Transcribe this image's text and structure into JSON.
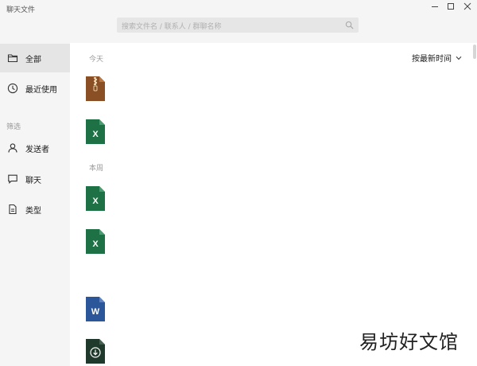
{
  "window": {
    "title": "聊天文件",
    "controls": {
      "minimize_icon": "minimize-icon",
      "maximize_icon": "maximize-icon",
      "close_icon": "close-icon"
    }
  },
  "search": {
    "placeholder": "搜索文件名 / 联系人 / 群聊名称",
    "icon": "search-icon"
  },
  "sidebar": {
    "items": [
      {
        "label": "全部",
        "icon": "folder-icon",
        "active": true
      },
      {
        "label": "最近使用",
        "icon": "clock-icon",
        "active": false
      }
    ],
    "filter_label": "筛选",
    "filters": [
      {
        "label": "发送者",
        "icon": "person-icon"
      },
      {
        "label": "聊天",
        "icon": "chat-bubble-icon"
      },
      {
        "label": "类型",
        "icon": "document-icon"
      }
    ]
  },
  "main": {
    "sort_label": "按最新时间",
    "sections": [
      {
        "label": "今天",
        "files": [
          {
            "type": "archive"
          },
          {
            "type": "excel",
            "glyph": "X"
          }
        ]
      },
      {
        "label": "本周",
        "files": [
          {
            "type": "excel",
            "glyph": "X"
          },
          {
            "type": "excel",
            "glyph": "X"
          },
          {
            "type": "word",
            "glyph": "W"
          },
          {
            "type": "download"
          }
        ]
      }
    ]
  },
  "watermark": "易坊好文馆",
  "colors": {
    "archive": "#8a4f24",
    "excel": "#1e7145",
    "word": "#2b579a",
    "download": "#1f3a2c",
    "sidebar_bg": "#f5f5f5",
    "active_bg": "#e5e5e5"
  }
}
